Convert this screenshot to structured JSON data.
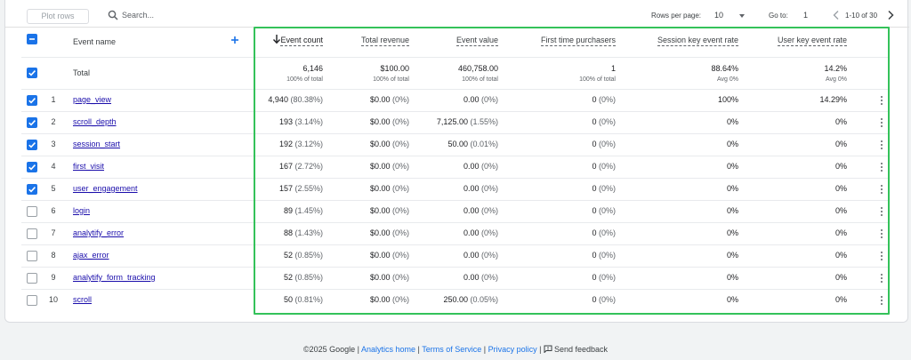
{
  "toolbar": {
    "plot_rows_label": "Plot rows",
    "search_placeholder": "Search...",
    "rows_per_page_label": "Rows per page:",
    "rows_per_page_value": "10",
    "goto_label": "Go to:",
    "goto_value": "1",
    "range_label": "1-10 of 30"
  },
  "table": {
    "event_name_header": "Event name",
    "metric_headers": [
      "Event count",
      "Total revenue",
      "Event value",
      "First time purchasers",
      "Session key event rate",
      "User key event rate"
    ],
    "total": {
      "label": "Total",
      "values": [
        "6,146",
        "$100.00",
        "460,758.00",
        "1",
        "88.64%",
        "14.2%"
      ],
      "subs": [
        "100% of total",
        "100% of total",
        "100% of total",
        "100% of total",
        "Avg 0%",
        "Avg 0%"
      ]
    },
    "rows": [
      {
        "num": "1",
        "name": "page_view",
        "checked": true,
        "event_count": "4,940",
        "event_count_pct": "(80.38%)",
        "revenue": "$0.00",
        "revenue_pct": "(0%)",
        "event_value": "0.00",
        "event_value_pct": "(0%)",
        "ftp": "0",
        "ftp_pct": "(0%)",
        "session_rate": "100%",
        "user_rate": "14.29%"
      },
      {
        "num": "2",
        "name": "scroll_depth",
        "checked": true,
        "event_count": "193",
        "event_count_pct": "(3.14%)",
        "revenue": "$0.00",
        "revenue_pct": "(0%)",
        "event_value": "7,125.00",
        "event_value_pct": "(1.55%)",
        "ftp": "0",
        "ftp_pct": "(0%)",
        "session_rate": "0%",
        "user_rate": "0%"
      },
      {
        "num": "3",
        "name": "session_start",
        "checked": true,
        "event_count": "192",
        "event_count_pct": "(3.12%)",
        "revenue": "$0.00",
        "revenue_pct": "(0%)",
        "event_value": "50.00",
        "event_value_pct": "(0.01%)",
        "ftp": "0",
        "ftp_pct": "(0%)",
        "session_rate": "0%",
        "user_rate": "0%"
      },
      {
        "num": "4",
        "name": "first_visit",
        "checked": true,
        "event_count": "167",
        "event_count_pct": "(2.72%)",
        "revenue": "$0.00",
        "revenue_pct": "(0%)",
        "event_value": "0.00",
        "event_value_pct": "(0%)",
        "ftp": "0",
        "ftp_pct": "(0%)",
        "session_rate": "0%",
        "user_rate": "0%"
      },
      {
        "num": "5",
        "name": "user_engagement",
        "checked": true,
        "event_count": "157",
        "event_count_pct": "(2.55%)",
        "revenue": "$0.00",
        "revenue_pct": "(0%)",
        "event_value": "0.00",
        "event_value_pct": "(0%)",
        "ftp": "0",
        "ftp_pct": "(0%)",
        "session_rate": "0%",
        "user_rate": "0%"
      },
      {
        "num": "6",
        "name": "login",
        "checked": false,
        "event_count": "89",
        "event_count_pct": "(1.45%)",
        "revenue": "$0.00",
        "revenue_pct": "(0%)",
        "event_value": "0.00",
        "event_value_pct": "(0%)",
        "ftp": "0",
        "ftp_pct": "(0%)",
        "session_rate": "0%",
        "user_rate": "0%"
      },
      {
        "num": "7",
        "name": "analytify_error",
        "checked": false,
        "event_count": "88",
        "event_count_pct": "(1.43%)",
        "revenue": "$0.00",
        "revenue_pct": "(0%)",
        "event_value": "0.00",
        "event_value_pct": "(0%)",
        "ftp": "0",
        "ftp_pct": "(0%)",
        "session_rate": "0%",
        "user_rate": "0%"
      },
      {
        "num": "8",
        "name": "ajax_error",
        "checked": false,
        "event_count": "52",
        "event_count_pct": "(0.85%)",
        "revenue": "$0.00",
        "revenue_pct": "(0%)",
        "event_value": "0.00",
        "event_value_pct": "(0%)",
        "ftp": "0",
        "ftp_pct": "(0%)",
        "session_rate": "0%",
        "user_rate": "0%"
      },
      {
        "num": "9",
        "name": "analytify_form_tracking",
        "checked": false,
        "event_count": "52",
        "event_count_pct": "(0.85%)",
        "revenue": "$0.00",
        "revenue_pct": "(0%)",
        "event_value": "0.00",
        "event_value_pct": "(0%)",
        "ftp": "0",
        "ftp_pct": "(0%)",
        "session_rate": "0%",
        "user_rate": "0%"
      },
      {
        "num": "10",
        "name": "scroll",
        "checked": false,
        "event_count": "50",
        "event_count_pct": "(0.81%)",
        "revenue": "$0.00",
        "revenue_pct": "(0%)",
        "event_value": "250.00",
        "event_value_pct": "(0.05%)",
        "ftp": "0",
        "ftp_pct": "(0%)",
        "session_rate": "0%",
        "user_rate": "0%"
      }
    ]
  },
  "footer": {
    "copyright": "©2025 Google",
    "analytics_home": "Analytics home",
    "terms": "Terms of Service",
    "privacy": "Privacy policy",
    "feedback": "Send feedback"
  },
  "colors": {
    "accent": "#1a73e8",
    "link": "#1a0dab",
    "highlight_border": "#34c25a"
  },
  "icons": [
    "search-icon",
    "chevron-down-icon",
    "chevron-left-icon",
    "chevron-right-icon",
    "add-icon",
    "arrow-down-icon",
    "more-vert-icon",
    "feedback-icon",
    "checkbox-icon"
  ]
}
